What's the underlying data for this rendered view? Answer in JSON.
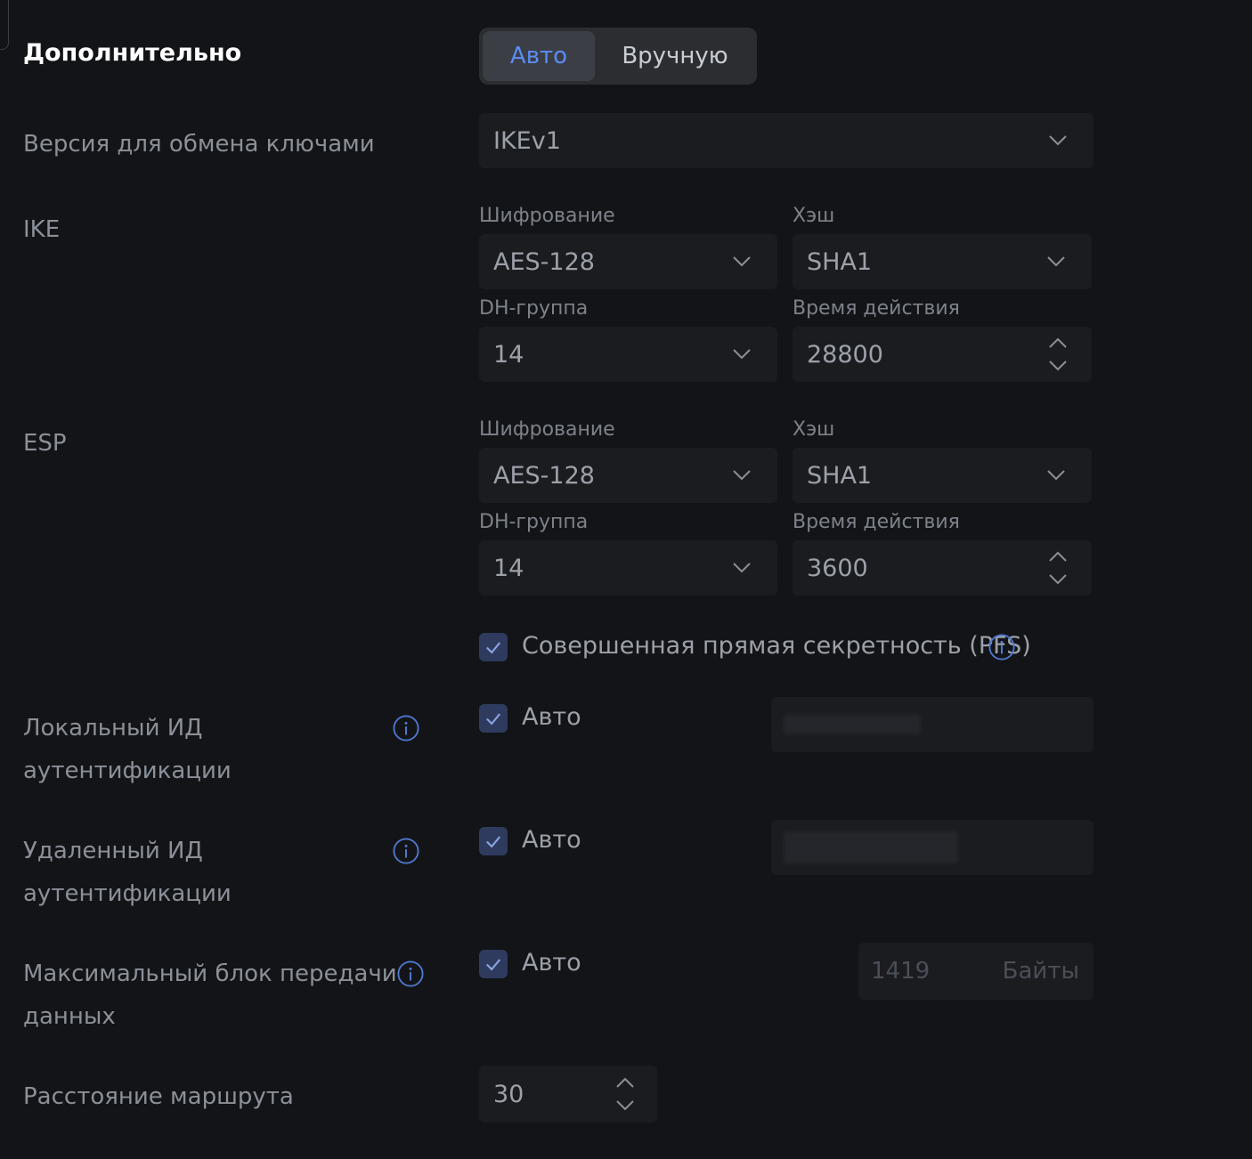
{
  "section": {
    "title": "Дополнительно",
    "mode_auto": "Авто",
    "mode_manual": "Вручную"
  },
  "key_exchange": {
    "label": "Версия для обмена ключами",
    "value": "IKEv1"
  },
  "ike": {
    "label": "IKE",
    "encryption_label": "Шифрование",
    "encryption": "AES-128",
    "hash_label": "Хэш",
    "hash": "SHA1",
    "dh_label": "DH-группа",
    "dh": "14",
    "lifetime_label": "Время действия",
    "lifetime": "28800"
  },
  "esp": {
    "label": "ESP",
    "encryption_label": "Шифрование",
    "encryption": "AES-128",
    "hash_label": "Хэш",
    "hash": "SHA1",
    "dh_label": "DH-группа",
    "dh": "14",
    "lifetime_label": "Время действия",
    "lifetime": "3600"
  },
  "pfs": {
    "label": "Совершенная прямая секретность (PFS)"
  },
  "local_id": {
    "label_line1": "Локальный ИД",
    "label_line2": "аутентификации",
    "auto_label": "Авто"
  },
  "remote_id": {
    "label_line1": "Удаленный ИД",
    "label_line2": "аутентификации",
    "auto_label": "Авто"
  },
  "mtu": {
    "label_line1": "Максимальный блок передачи",
    "label_line2": "данных",
    "auto_label": "Авто",
    "value": "1419",
    "unit": "Байты"
  },
  "route_distance": {
    "label": "Расстояние маршрута",
    "value": "30"
  },
  "colors": {
    "background": "#131417",
    "field": "#1b1c20",
    "accent": "#5b8cf5",
    "checkbox": "#2e3b5e"
  }
}
